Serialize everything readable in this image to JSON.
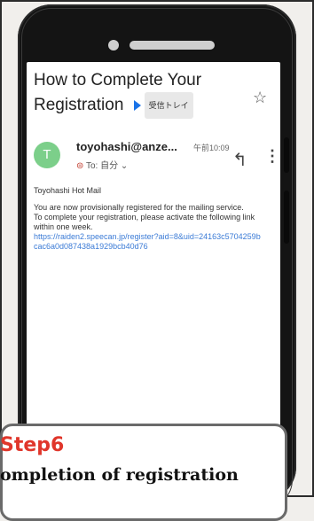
{
  "email": {
    "subject": "How to Complete Your Registration",
    "label": "受信トレイ",
    "avatar_letter": "T",
    "sender": "toyohashi@anze...",
    "time": "午前10:09",
    "to_line": "To: 自分 ⌄",
    "greeting": "Toyohashi Hot Mail",
    "body_line1": "You are now provisionally registered for the mailing service.",
    "body_line2": "To complete your registration, please activate the following link within one week.",
    "link": "https://raiden2.speecan.jp/register?aid=8&uid=24163c5704259b cac6a0d087438a1929bcb40d76"
  },
  "step": {
    "label": "Step6",
    "title": "ompletion of registration"
  },
  "colors": {
    "avatar": "#7ccf8a",
    "step_label": "#e0362b",
    "link": "#3b7bd6",
    "label_arrow": "#1a73e8"
  }
}
